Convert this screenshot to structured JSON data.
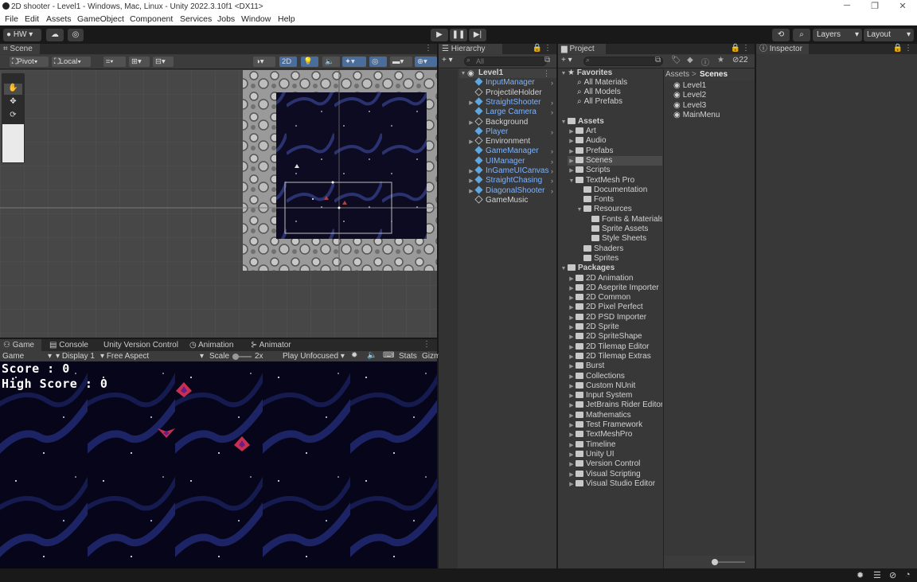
{
  "window": {
    "title": "2D shooter - Level1 - Windows, Mac, Linux - Unity 2022.3.10f1 <DX11>"
  },
  "menu": [
    "File",
    "Edit",
    "Assets",
    "GameObject",
    "Component",
    "Services",
    "Jobs",
    "Window",
    "Help"
  ],
  "toolbar": {
    "account": "HW",
    "layers": "Layers",
    "layout": "Layout"
  },
  "scene": {
    "tab": "Scene",
    "pivot": "Pivot",
    "local": "Local",
    "mode2d": "2D"
  },
  "game": {
    "tabs": [
      "Game",
      "Console",
      "Unity Version Control",
      "Animation",
      "Animator"
    ],
    "view": "Game",
    "display": "Display 1",
    "aspect": "Free Aspect",
    "scale_label": "Scale",
    "scale_value": "2x",
    "play_mode": "Play Unfocused",
    "stats": "Stats",
    "gizmos": "Gizm",
    "score": "Score : 0",
    "high_score": "High Score : 0"
  },
  "hierarchy": {
    "tab": "Hierarchy",
    "search_placeholder": "All",
    "root": "Level1",
    "items": [
      {
        "label": "InputManager",
        "prefab": true,
        "expandable": false
      },
      {
        "label": "ProjectileHolder",
        "prefab": false,
        "expandable": false
      },
      {
        "label": "StraightShooter",
        "prefab": true,
        "expandable": true
      },
      {
        "label": "Large Camera",
        "prefab": true,
        "expandable": false
      },
      {
        "label": "Background",
        "prefab": false,
        "expandable": true
      },
      {
        "label": "Player",
        "prefab": true,
        "expandable": false
      },
      {
        "label": "Environment",
        "prefab": false,
        "expandable": true
      },
      {
        "label": "GameManager",
        "prefab": true,
        "expandable": false
      },
      {
        "label": "UIManager",
        "prefab": true,
        "expandable": false
      },
      {
        "label": "InGameUICanvas",
        "prefab": true,
        "expandable": true
      },
      {
        "label": "StraightChasing",
        "prefab": true,
        "expandable": true
      },
      {
        "label": "DiagonalShooter",
        "prefab": true,
        "expandable": true
      },
      {
        "label": "GameMusic",
        "prefab": false,
        "expandable": false
      }
    ]
  },
  "project": {
    "tab": "Project",
    "hidden_count": "22",
    "favorites": {
      "label": "Favorites",
      "items": [
        "All Materials",
        "All Models",
        "All Prefabs"
      ]
    },
    "assets": {
      "label": "Assets",
      "items": [
        {
          "label": "Art",
          "indent": 1,
          "open": false
        },
        {
          "label": "Audio",
          "indent": 1,
          "open": false
        },
        {
          "label": "Prefabs",
          "indent": 1,
          "open": false
        },
        {
          "label": "Scenes",
          "indent": 1,
          "open": false,
          "selected": true
        },
        {
          "label": "Scripts",
          "indent": 1,
          "open": false
        },
        {
          "label": "TextMesh Pro",
          "indent": 1,
          "open": true
        },
        {
          "label": "Documentation",
          "indent": 2,
          "leaf": true
        },
        {
          "label": "Fonts",
          "indent": 2,
          "leaf": true
        },
        {
          "label": "Resources",
          "indent": 2,
          "open": true
        },
        {
          "label": "Fonts & Materials",
          "indent": 3,
          "leaf": true
        },
        {
          "label": "Sprite Assets",
          "indent": 3,
          "leaf": true
        },
        {
          "label": "Style Sheets",
          "indent": 3,
          "leaf": true
        },
        {
          "label": "Shaders",
          "indent": 2,
          "leaf": true
        },
        {
          "label": "Sprites",
          "indent": 2,
          "leaf": true
        }
      ]
    },
    "packages": {
      "label": "Packages",
      "items": [
        "2D Animation",
        "2D Aseprite Importer",
        "2D Common",
        "2D Pixel Perfect",
        "2D PSD Importer",
        "2D Sprite",
        "2D SpriteShape",
        "2D Tilemap Editor",
        "2D Tilemap Extras",
        "Burst",
        "Collections",
        "Custom NUnit",
        "Input System",
        "JetBrains Rider Editor",
        "Mathematics",
        "Test Framework",
        "TextMeshPro",
        "Timeline",
        "Unity UI",
        "Version Control",
        "Visual Scripting",
        "Visual Studio Editor"
      ]
    },
    "breadcrumb": [
      "Assets",
      "Scenes"
    ],
    "files": [
      "Level1",
      "Level2",
      "Level3",
      "MainMenu"
    ]
  },
  "inspector": {
    "tab": "Inspector"
  }
}
